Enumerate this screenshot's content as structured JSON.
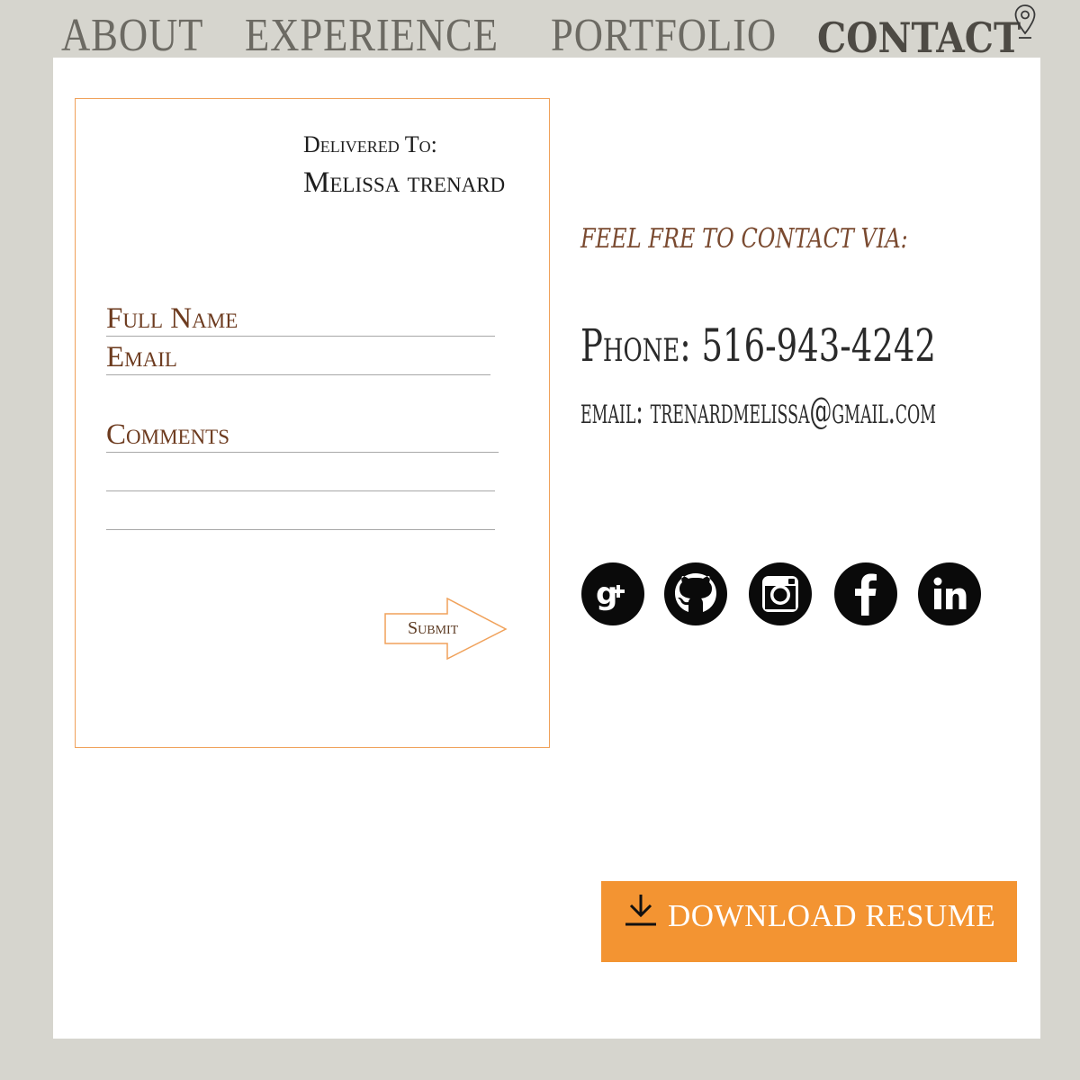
{
  "nav": {
    "items": [
      {
        "label": "ABOUT"
      },
      {
        "label": "EXPERIENCE"
      },
      {
        "label": "PORTFOLIO"
      },
      {
        "label": "CONTACT"
      }
    ],
    "active": "CONTACT",
    "pin_icon": "map-pin-icon"
  },
  "form": {
    "delivered_label": "Delivered To:",
    "delivered_name": "Melissa trenard",
    "full_name_label": "Full Name",
    "email_label": "Email",
    "comments_label": "Comments",
    "submit_label": "Submit"
  },
  "contact": {
    "heading": "FEEL FRE TO CONTACT VIA:",
    "phone": "Phone: 516-943-4242",
    "email": "email: trenardmelissa@gmail.com"
  },
  "social": [
    {
      "name": "google-plus-icon"
    },
    {
      "name": "github-icon"
    },
    {
      "name": "instagram-icon"
    },
    {
      "name": "facebook-icon"
    },
    {
      "name": "linkedin-icon"
    }
  ],
  "download": {
    "label": "DOWNLOAD RESUME",
    "icon": "download-icon"
  },
  "colors": {
    "background": "#d6d5ce",
    "panel": "#ffffff",
    "accent_orange": "#f39432",
    "form_border": "#f0a15a",
    "label_brown": "#6d3b1f",
    "nav_gray": "#6c6a63"
  }
}
